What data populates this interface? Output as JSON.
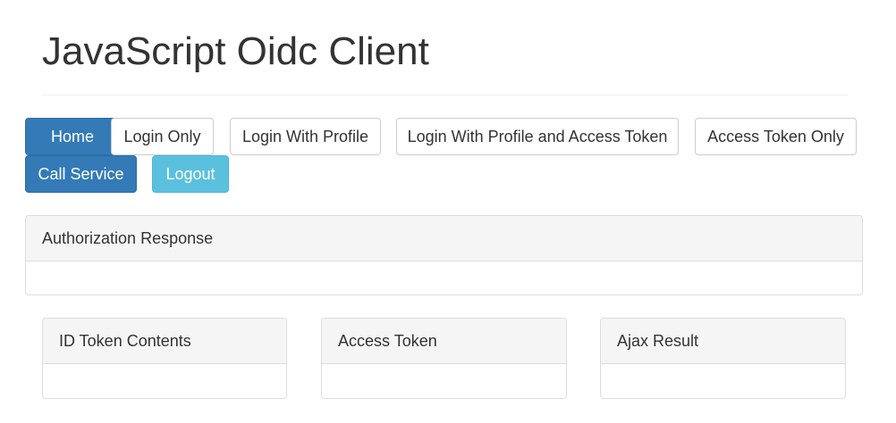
{
  "header": {
    "title": "JavaScript Oidc Client"
  },
  "toolbar": {
    "buttons": [
      {
        "label": "Home",
        "style": "primary"
      },
      {
        "label": "Login Only",
        "style": "default"
      },
      {
        "label": "Login With Profile",
        "style": "default"
      },
      {
        "label": "Login With Profile and Access Token",
        "style": "default"
      },
      {
        "label": "Access Token Only",
        "style": "default"
      },
      {
        "label": "Call Service",
        "style": "primary"
      },
      {
        "label": "Logout",
        "style": "info"
      }
    ]
  },
  "panels": {
    "authorization_response": {
      "title": "Authorization Response",
      "body": ""
    },
    "id_token": {
      "title": "ID Token Contents",
      "body": ""
    },
    "access_token": {
      "title": "Access Token",
      "body": ""
    },
    "ajax_result": {
      "title": "Ajax Result",
      "body": ""
    }
  },
  "colors": {
    "primary": "#337ab7",
    "info": "#5bc0de",
    "default_border": "#cccccc",
    "panel_heading_bg": "#f5f5f5"
  }
}
